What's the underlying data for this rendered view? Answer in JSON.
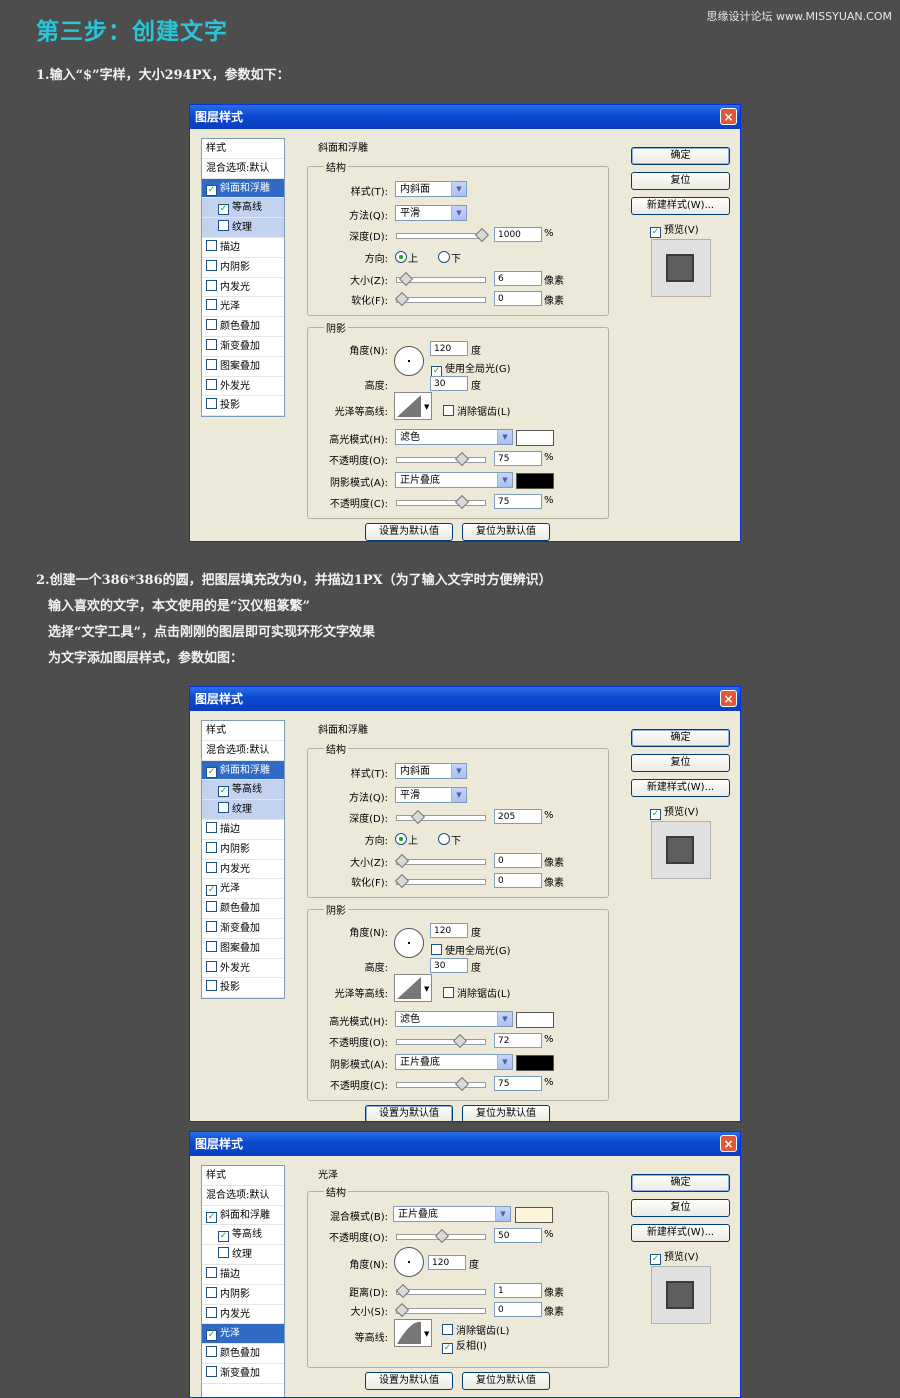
{
  "title": "第三步：创建文字",
  "watermark": "思缘设计论坛 www.MISSYUAN.COM",
  "step1_text": "1.输入“$”字样，大小294PX，参数如下：",
  "step2_lines": [
    "2.创建一个386*386的圆，把图层填充改为0，并描边1PX（为了输入文字时方便辨识）",
    "输入喜欢的文字，本文使用的是“汉仪粗篆繁”",
    "选择“文字工具”，点击刚刚的图层即可实现环形文字效果",
    "为文字添加图层样式，参数如图："
  ],
  "colors": {
    "title": "#29c6d9",
    "selected": "#316ac5",
    "titlebar": "#0a49d0"
  },
  "dialog1": {
    "window_title": "图层样式",
    "close_icon": "×",
    "left_panel": {
      "header": "样式",
      "blend": "混合选项:默认",
      "items": [
        {
          "label": "斜面和浮雕",
          "checked": true,
          "sub": false,
          "selected": true
        },
        {
          "label": "等高线",
          "checked": true,
          "sub": true
        },
        {
          "label": "纹理",
          "checked": false,
          "sub": true
        },
        {
          "label": "描边",
          "checked": false,
          "sub": false
        },
        {
          "label": "内阴影",
          "checked": false,
          "sub": false
        },
        {
          "label": "内发光",
          "checked": false,
          "sub": false
        },
        {
          "label": "光泽",
          "checked": false,
          "sub": false
        },
        {
          "label": "颜色叠加",
          "checked": false,
          "sub": false
        },
        {
          "label": "渐变叠加",
          "checked": false,
          "sub": false
        },
        {
          "label": "图案叠加",
          "checked": false,
          "sub": false
        },
        {
          "label": "外发光",
          "checked": false,
          "sub": false
        },
        {
          "label": "投影",
          "checked": false,
          "sub": false
        }
      ]
    },
    "section": "斜面和浮雕",
    "structure_label": "结构",
    "style_label": "样式(T):",
    "style_value": "内斜面",
    "method_label": "方法(Q):",
    "method_value": "平滑",
    "depth_label": "深度(D):",
    "depth_value": "1000",
    "depth_pct": 1.0,
    "direction_label": "方向:",
    "up": "上",
    "down": "下",
    "size_label": "大小(Z):",
    "size_value": "6",
    "size_pct": 0.05,
    "soften_label": "软化(F):",
    "soften_value": "0",
    "soften_pct": 0.0,
    "shadow_label": "阴影",
    "angle_label": "角度(N):",
    "angle_value": "120",
    "global_light": "使用全局光(G)",
    "global_checked": true,
    "altitude_label": "高度:",
    "altitude_value": "30",
    "gloss_label": "光泽等高线:",
    "antialias": "消除锯齿(L)",
    "highlight_label": "高光模式(H):",
    "highlight_value": "滤色",
    "highlight_color": "#ffffff",
    "hl_opacity_label": "不透明度(O):",
    "hl_opacity_value": "75",
    "hl_opacity_pct": 0.75,
    "shadowmode_label": "阴影模式(A):",
    "shadowmode_value": "正片叠底",
    "shadow_color": "#000000",
    "sh_opacity_label": "不透明度(C):",
    "sh_opacity_value": "75",
    "sh_opacity_pct": 0.75,
    "pct": "%",
    "px": "像素",
    "deg": "度",
    "btn_default": "设置为默认值",
    "btn_reset_default": "复位为默认值",
    "ok": "确定",
    "reset": "复位",
    "new_style": "新建样式(W)...",
    "preview": "预览(V)"
  },
  "dialog2": {
    "window_title": "图层样式",
    "close_icon": "×",
    "left_panel": {
      "header": "样式",
      "blend": "混合选项:默认",
      "items": [
        {
          "label": "斜面和浮雕",
          "checked": true,
          "sub": false,
          "selected": true
        },
        {
          "label": "等高线",
          "checked": true,
          "sub": true
        },
        {
          "label": "纹理",
          "checked": false,
          "sub": true
        },
        {
          "label": "描边",
          "checked": false,
          "sub": false
        },
        {
          "label": "内阴影",
          "checked": false,
          "sub": false
        },
        {
          "label": "内发光",
          "checked": false,
          "sub": false
        },
        {
          "label": "光泽",
          "checked": true,
          "sub": false
        },
        {
          "label": "颜色叠加",
          "checked": false,
          "sub": false
        },
        {
          "label": "渐变叠加",
          "checked": false,
          "sub": false
        },
        {
          "label": "图案叠加",
          "checked": false,
          "sub": false
        },
        {
          "label": "外发光",
          "checked": false,
          "sub": false
        },
        {
          "label": "投影",
          "checked": false,
          "sub": false
        }
      ]
    },
    "section": "斜面和浮雕",
    "structure_label": "结构",
    "style_label": "样式(T):",
    "style_value": "内斜面",
    "method_label": "方法(Q):",
    "method_value": "平滑",
    "depth_label": "深度(D):",
    "depth_value": "205",
    "depth_pct": 0.2,
    "direction_label": "方向:",
    "up": "上",
    "down": "下",
    "size_label": "大小(Z):",
    "size_value": "0",
    "size_pct": 0.0,
    "soften_label": "软化(F):",
    "soften_value": "0",
    "soften_pct": 0.0,
    "shadow_label": "阴影",
    "angle_label": "角度(N):",
    "angle_value": "120",
    "global_light": "使用全局光(G)",
    "global_checked": false,
    "altitude_label": "高度:",
    "altitude_value": "30",
    "gloss_label": "光泽等高线:",
    "antialias": "消除锯齿(L)",
    "highlight_label": "高光模式(H):",
    "highlight_value": "滤色",
    "highlight_color": "#ffffff",
    "hl_opacity_label": "不透明度(O):",
    "hl_opacity_value": "72",
    "hl_opacity_pct": 0.72,
    "shadowmode_label": "阴影模式(A):",
    "shadowmode_value": "正片叠底",
    "shadow_color": "#000000",
    "sh_opacity_label": "不透明度(C):",
    "sh_opacity_value": "75",
    "sh_opacity_pct": 0.75,
    "pct": "%",
    "px": "像素",
    "deg": "度",
    "btn_default": "设置为默认值",
    "btn_reset_default": "复位为默认值",
    "ok": "确定",
    "reset": "复位",
    "new_style": "新建样式(W)...",
    "preview": "预览(V)"
  },
  "dialog3": {
    "window_title": "图层样式",
    "close_icon": "×",
    "left_panel": {
      "header": "样式",
      "blend": "混合选项:默认",
      "items": [
        {
          "label": "斜面和浮雕",
          "checked": true,
          "sub": false
        },
        {
          "label": "等高线",
          "checked": true,
          "sub": true
        },
        {
          "label": "纹理",
          "checked": false,
          "sub": true
        },
        {
          "label": "描边",
          "checked": false,
          "sub": false
        },
        {
          "label": "内阴影",
          "checked": false,
          "sub": false
        },
        {
          "label": "内发光",
          "checked": false,
          "sub": false
        },
        {
          "label": "光泽",
          "checked": true,
          "sub": false,
          "selected": true
        },
        {
          "label": "颜色叠加",
          "checked": false,
          "sub": false
        },
        {
          "label": "渐变叠加",
          "checked": false,
          "sub": false
        }
      ]
    },
    "section": "光泽",
    "structure_label": "结构",
    "blend_label": "混合模式(B):",
    "blend_value": "正片叠底",
    "blend_color": "#fdf3d6",
    "opacity_label": "不透明度(O):",
    "opacity_value": "50",
    "opacity_pct": 0.5,
    "angle_label": "角度(N):",
    "angle_value": "120",
    "deg": "度",
    "distance_label": "距离(D):",
    "distance_value": "1",
    "distance_pct": 0.01,
    "size_label": "大小(S):",
    "size_value": "0",
    "size_pct": 0.0,
    "contour_label": "等高线:",
    "antialias": "消除锯齿(L)",
    "invert": "反相(I)",
    "pct": "%",
    "px": "像素",
    "btn_default": "设置为默认值",
    "btn_reset_default": "复位为默认值",
    "ok": "确定",
    "reset": "复位",
    "new_style": "新建样式(W)...",
    "preview": "预览(V)"
  }
}
